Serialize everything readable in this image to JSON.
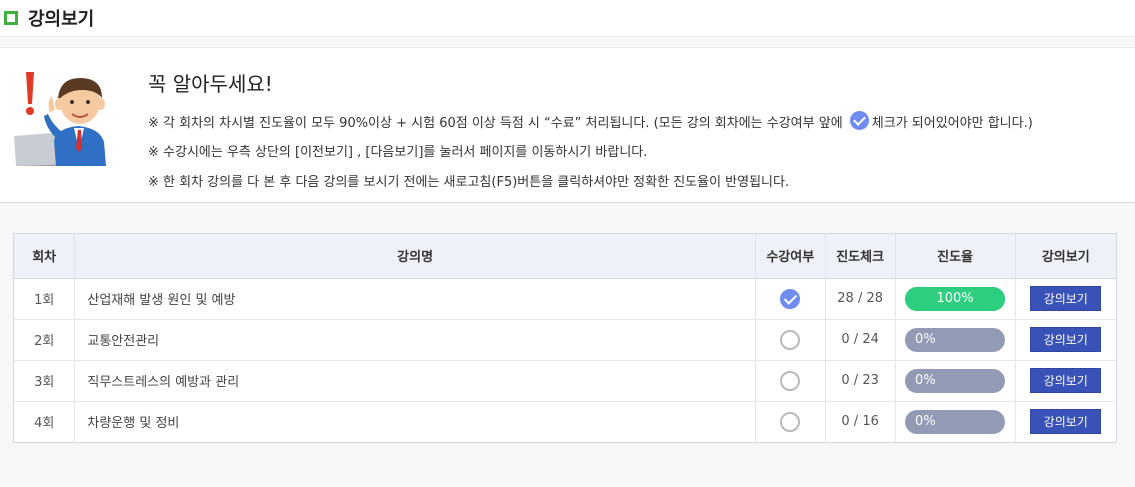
{
  "header": {
    "title": "강의보기"
  },
  "notice": {
    "heading": "꼭 알아두세요!",
    "line1_before": "※ 각 회차의 차시별 진도율이 모두 90%이상 + 시험 60점 이상 득점 시 “수료” 처리됩니다. (모든 강의 회차에는 수강여부 앞에",
    "line1_after": "체크가 되어있어야만 합니다.)",
    "line2": "※ 수강시에는 우측 상단의 [이전보기] , [다음보기]를 눌러서 페이지를 이동하시기 바랍니다.",
    "line3": "※ 한 회차 강의를 다 본 후 다음 강의를 보시기 전에는 새로고침(F5)버튼을 클릭하셔야만 정확한 진도율이 반영됩니다."
  },
  "table": {
    "headers": {
      "round": "회차",
      "name": "강의명",
      "attended": "수강여부",
      "progress_check": "진도체크",
      "progress_rate": "진도율",
      "view": "강의보기"
    },
    "rows": [
      {
        "round": "1회",
        "name": "산업재해 발생 원인 및 예방",
        "attended": true,
        "progress_check": "28 / 28",
        "rate_label": "100%",
        "rate_value": 1.0,
        "button": "강의보기"
      },
      {
        "round": "2회",
        "name": "교통안전관리",
        "attended": false,
        "progress_check": "0 / 24",
        "rate_label": "0%",
        "rate_value": 0.0,
        "button": "강의보기"
      },
      {
        "round": "3회",
        "name": "직무스트레스의 예방과 관리",
        "attended": false,
        "progress_check": "0 / 23",
        "rate_label": "0%",
        "rate_value": 0.0,
        "button": "강의보기"
      },
      {
        "round": "4회",
        "name": "차량운행 및 정비",
        "attended": false,
        "progress_check": "0 / 16",
        "rate_label": "0%",
        "rate_value": 0.0,
        "button": "강의보기"
      }
    ]
  },
  "colors": {
    "accent": "#3852b8",
    "progress_full": "#2dce7f",
    "progress_empty": "#939ab4",
    "check": "#6f8cf0",
    "title_square": "#3fb13f"
  }
}
